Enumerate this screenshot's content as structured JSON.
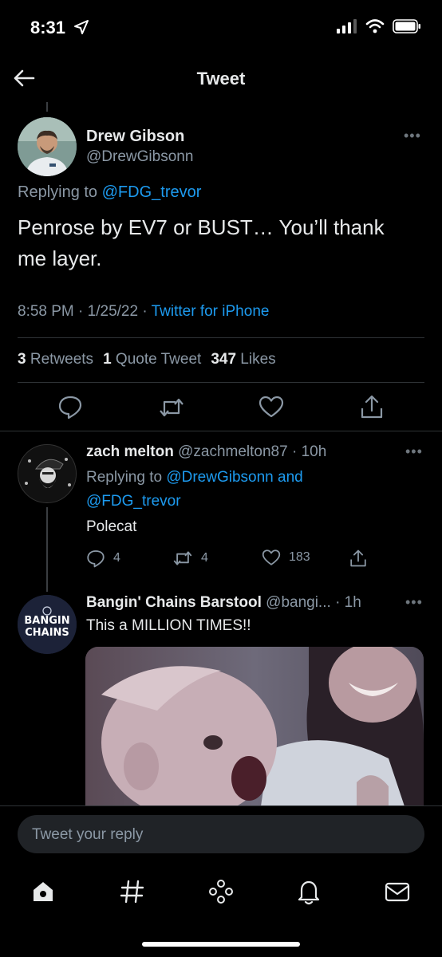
{
  "status_bar": {
    "time": "8:31"
  },
  "nav": {
    "title": "Tweet"
  },
  "main_tweet": {
    "name": "Drew Gibson",
    "handle": "@DrewGibsonn",
    "replying_prefix": "Replying to",
    "replying_to": "@FDG_trevor",
    "text": "Penrose by EV7 or BUST… You’ll thank me layer.",
    "time": "8:58 PM",
    "date": "1/25/22",
    "source": "Twitter for iPhone",
    "stats": {
      "retweets_count": "3",
      "retweets_label": "Retweets",
      "quote_count": "1",
      "quote_label": "Quote Tweet",
      "likes_count": "347",
      "likes_label": "Likes"
    }
  },
  "reply_1": {
    "name": "zach melton",
    "handle": "@zachmelton87",
    "age": "10h",
    "replying_prefix": "Replying to",
    "replying_to_1": "@DrewGibsonn",
    "replying_and": "and",
    "replying_to_2": "@FDG_trevor",
    "text": "Polecat",
    "replies": "4",
    "retweets": "4",
    "likes": "183"
  },
  "reply_2": {
    "name": "Bangin' Chains Barstool",
    "handle": "@bangi...",
    "age": "1h",
    "text": "This a MILLION TIMES!!",
    "avatar_text": "BANGIN CHAINS"
  },
  "composer": {
    "placeholder": "Tweet your reply"
  },
  "tabbar": {
    "items": [
      "home-icon",
      "explore-icon",
      "spaces-icon",
      "notifications-icon",
      "messages-icon"
    ]
  },
  "colors": {
    "accent": "#1d9bf0",
    "background": "#000000",
    "secondary_text": "#8b98a5"
  }
}
